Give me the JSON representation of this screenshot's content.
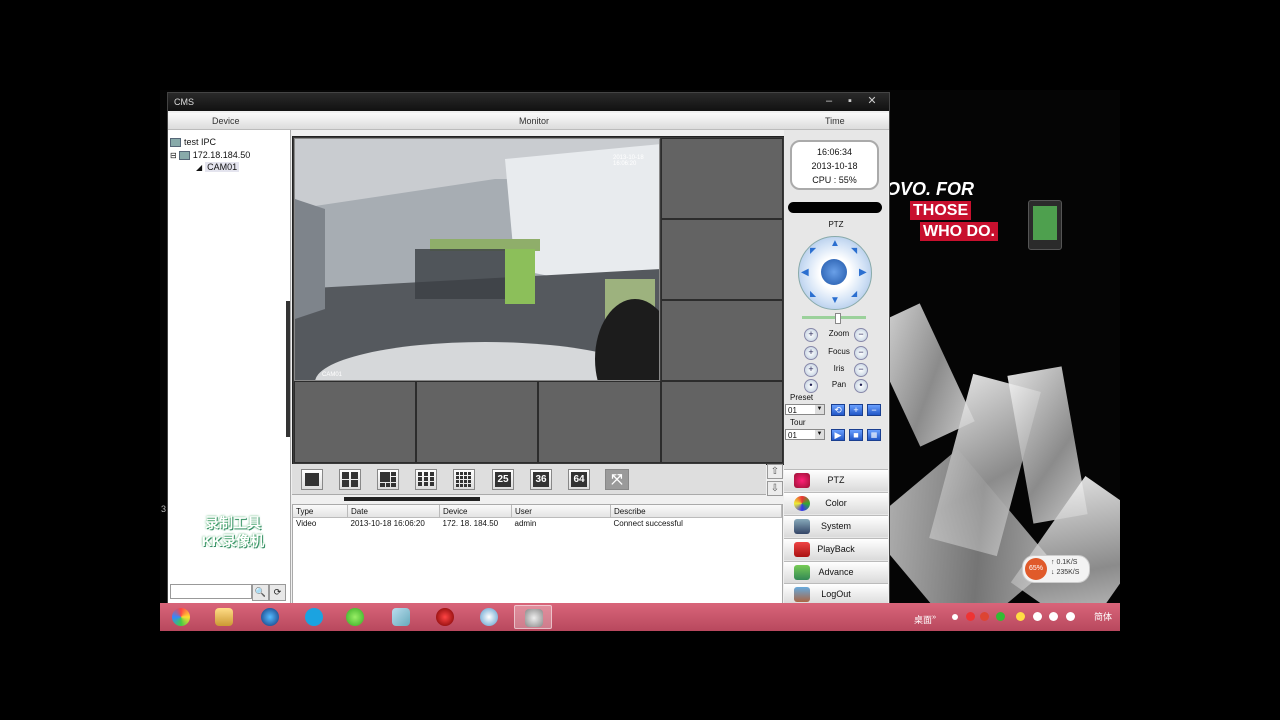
{
  "window": {
    "title": "CMS"
  },
  "headers": {
    "device": "Device",
    "monitor": "Monitor",
    "time": "Time"
  },
  "tree": {
    "items": [
      {
        "label": "test IPC"
      },
      {
        "label": "172.18.184.50"
      },
      {
        "label": "CAM01"
      }
    ],
    "expand_glyph": "⊟",
    "watermark_line1": "录制工具",
    "watermark_line2": "KK录像机",
    "search_button_glyph": "🔍",
    "refresh_button_glyph": "⟳"
  },
  "monitor": {
    "camera_timestamp": "2013-10-18 16:06:20",
    "camera_label": "CAM01"
  },
  "layout_toolbar": {
    "buttons": [
      "1",
      "4",
      "6",
      "9",
      "16",
      "25",
      "36",
      "64",
      "fullscreen"
    ],
    "labels": {
      "b25": "25",
      "b36": "36",
      "b64": "64"
    }
  },
  "log": {
    "columns": [
      "Type",
      "Date",
      "Device",
      "User",
      "Describe"
    ],
    "rows": [
      {
        "type": "Video",
        "date": "2013-10-18 16:06:20",
        "device": "172. 18. 184.50",
        "user": "admin",
        "describe": "Connect successful"
      }
    ]
  },
  "clock": {
    "time": "16:06:34",
    "date": "2013-10-18",
    "cpu": "CPU : 55%"
  },
  "ptz": {
    "title": "PTZ",
    "zoom_label": "Zoom",
    "focus_label": "Focus",
    "iris_label": "Iris",
    "pan_label": "Pan",
    "preset_label": "Preset",
    "preset_value": "01",
    "tour_label": "Tour",
    "tour_value": "01"
  },
  "menu": {
    "ptz": "PTZ",
    "color": "Color",
    "system": "System",
    "playback": "PlayBack",
    "advance": "Advance",
    "logout": "LogOut"
  },
  "desktop": {
    "brand_line1": "OVO. FOR",
    "brand_line2": "THOSE",
    "brand_line3": "WHO DO.",
    "net_percent": "65%",
    "net_up": "↑ 0.1K/S",
    "net_down": "↓ 235K/S",
    "side_digit": "3"
  },
  "taskbar": {
    "desktop_label": "桌面",
    "chevron": "»",
    "ime_label": "简体"
  },
  "colors": {
    "accent": "#2257c7",
    "taskbar": "#c9566c",
    "brand_red": "#c8102e"
  }
}
